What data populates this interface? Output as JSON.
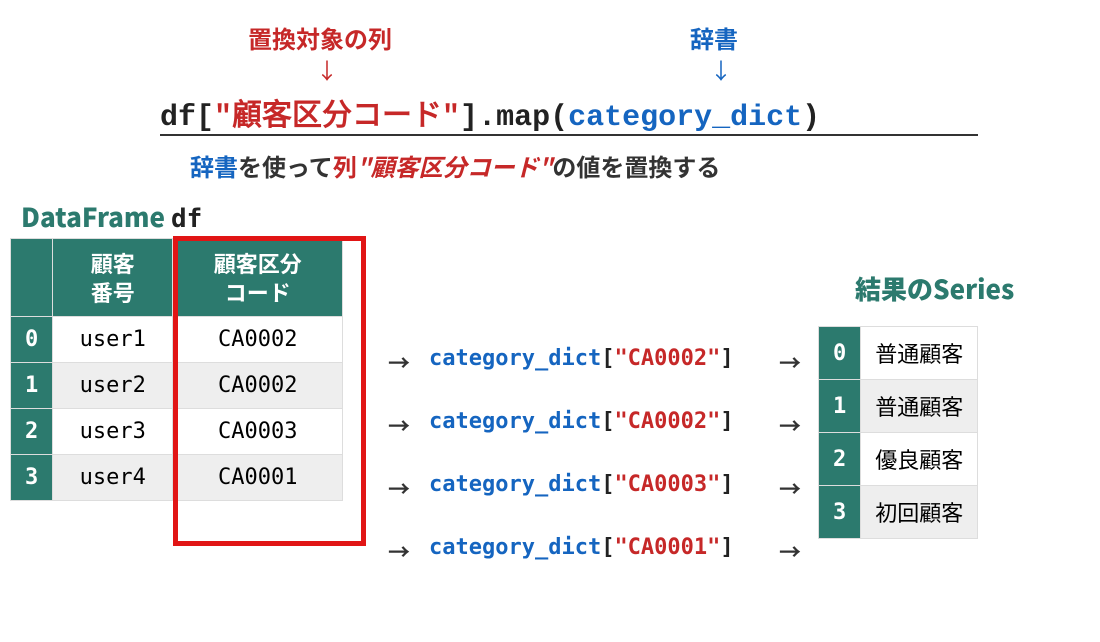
{
  "annotations": {
    "column_target": "置換対象の列",
    "dict": "辞書"
  },
  "code": {
    "df": "df",
    "column": "\"顧客区分コード\"",
    "map": ".map",
    "dictname": "category_dict"
  },
  "description": {
    "dict_word": "辞書",
    "mid1": "を使って",
    "col_word": "列",
    "col_literal": "\"顧客区分コード\"",
    "tail": "の値を置換する"
  },
  "dataframe": {
    "type_label": "DataFrame",
    "var_name": "df",
    "columns": [
      {
        "l1": "顧客",
        "l2": "番号"
      },
      {
        "l1": "顧客区分",
        "l2": "コード"
      }
    ],
    "rows": [
      {
        "idx": "0",
        "user": "user1",
        "code": "CA0002"
      },
      {
        "idx": "1",
        "user": "user2",
        "code": "CA0002"
      },
      {
        "idx": "2",
        "user": "user3",
        "code": "CA0003"
      },
      {
        "idx": "3",
        "user": "user4",
        "code": "CA0001"
      }
    ]
  },
  "mappings": {
    "dictname": "category_dict",
    "items": [
      {
        "key": "\"CA0002\""
      },
      {
        "key": "\"CA0002\""
      },
      {
        "key": "\"CA0003\""
      },
      {
        "key": "\"CA0001\""
      }
    ]
  },
  "result": {
    "title": "結果のSeries",
    "rows": [
      {
        "idx": "0",
        "value": "普通顧客"
      },
      {
        "idx": "1",
        "value": "普通顧客"
      },
      {
        "idx": "2",
        "value": "優良顧客"
      },
      {
        "idx": "3",
        "value": "初回顧客"
      }
    ]
  }
}
